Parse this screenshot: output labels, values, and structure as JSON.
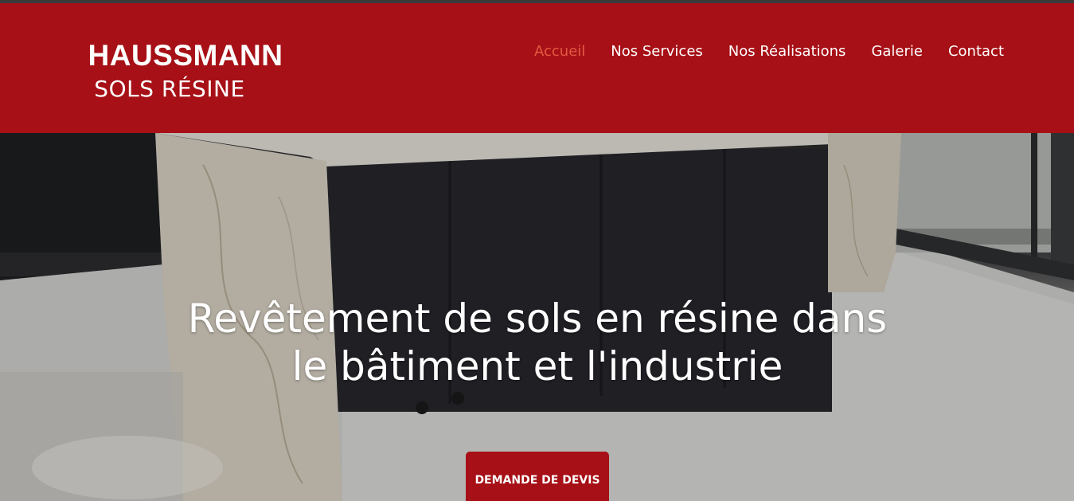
{
  "brand": {
    "line1": "HAUSSMANN",
    "line2": "SOLS RÉSINE",
    "color": "#a61016"
  },
  "nav": {
    "items": [
      {
        "label": "Accueil",
        "active": true
      },
      {
        "label": "Nos Services",
        "active": false
      },
      {
        "label": "Nos Réalisations",
        "active": false
      },
      {
        "label": "Galerie",
        "active": false
      },
      {
        "label": "Contact",
        "active": false
      }
    ],
    "active_color": "#e45a44"
  },
  "hero": {
    "headline_line1": "Revêtement de sols en résine dans",
    "headline_line2": "le bâtiment et l'industrie",
    "cta_label": "DEMANDE DE DEVIS"
  }
}
